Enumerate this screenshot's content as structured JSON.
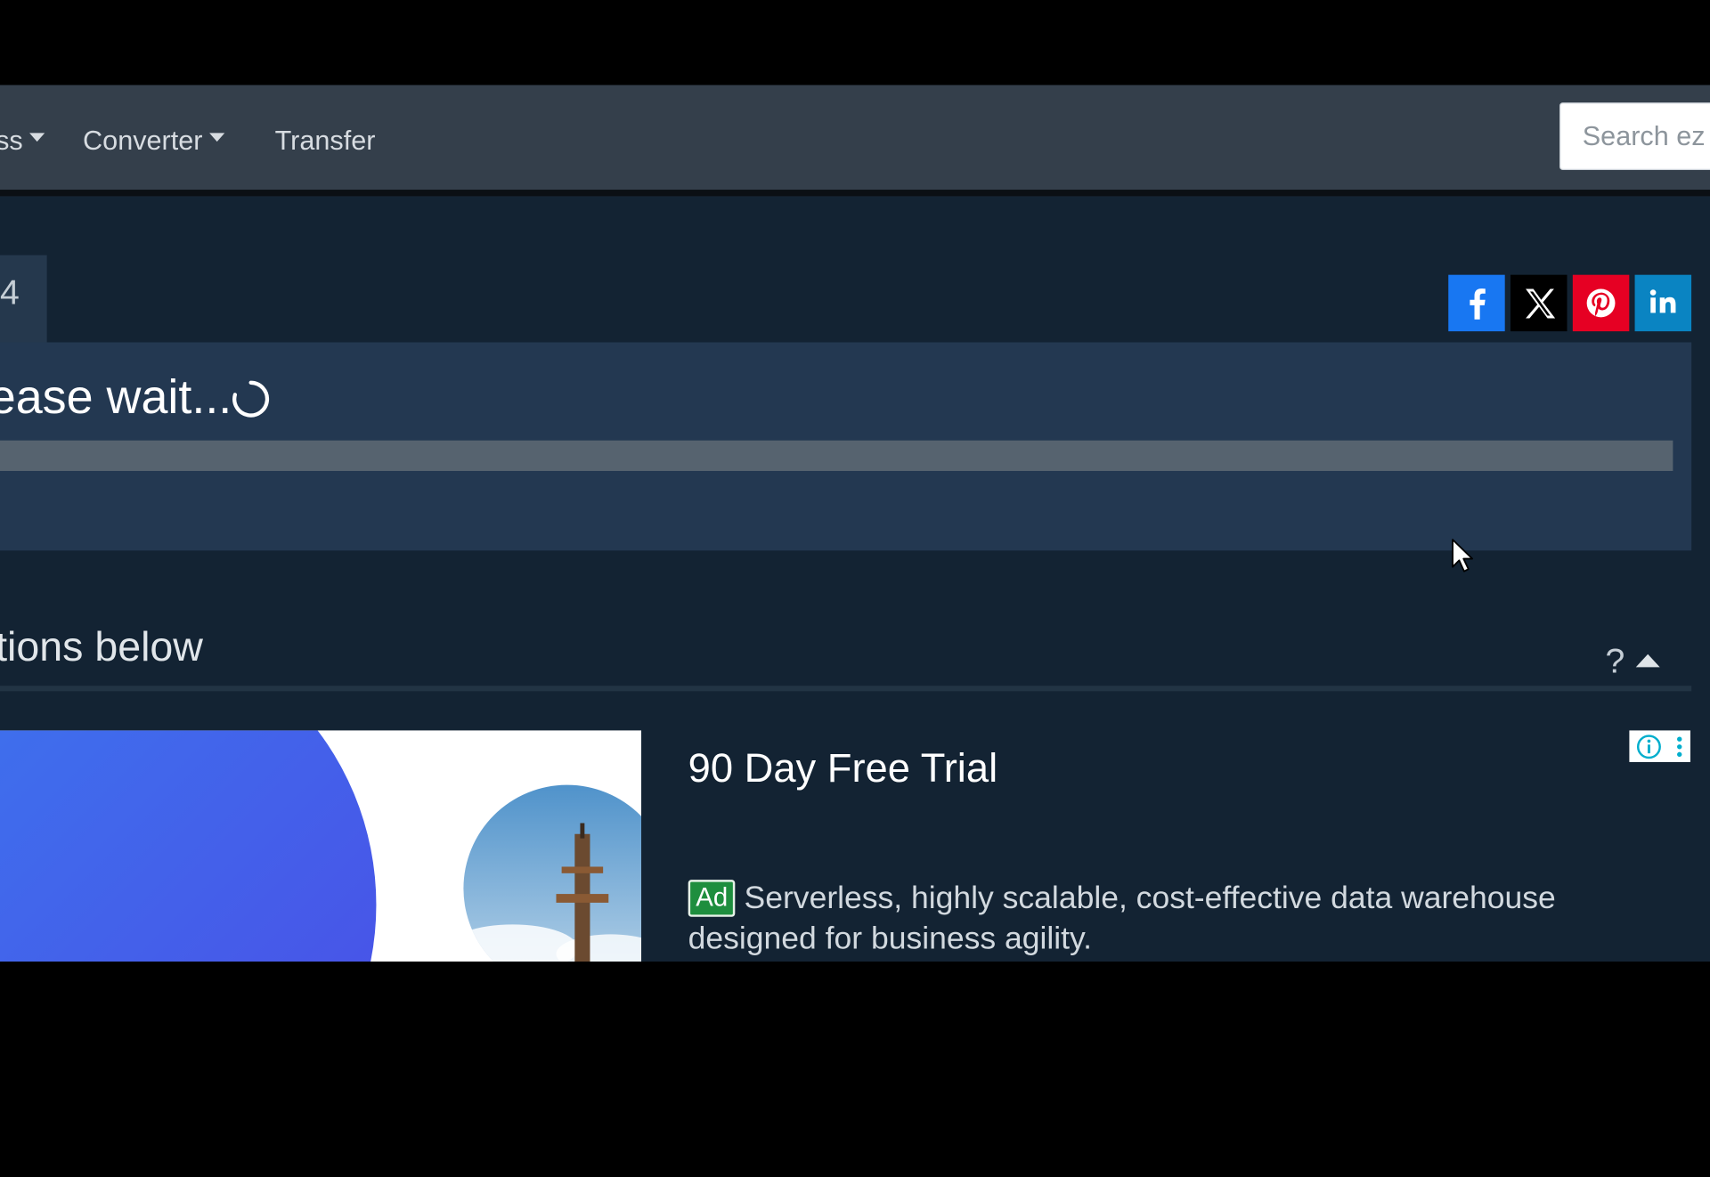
{
  "nav": {
    "items": [
      {
        "label": "ss",
        "has_caret": true
      },
      {
        "label": "Converter",
        "has_caret": true
      },
      {
        "label": "Transfer",
        "has_caret": false
      }
    ],
    "search_placeholder": "Search ez"
  },
  "tab_stub_text": "4",
  "share": {
    "buttons": [
      {
        "name": "facebook",
        "icon": "facebook-icon",
        "color": "#1877f2"
      },
      {
        "name": "x",
        "icon": "x-icon",
        "color": "#000000"
      },
      {
        "name": "pinterest",
        "icon": "pinterest-icon",
        "color": "#e60023"
      },
      {
        "name": "linkedin",
        "icon": "linkedin-icon",
        "color": "#0a84c2"
      }
    ]
  },
  "status": {
    "wait_text": "ease wait...",
    "progress_percent": 0
  },
  "options": {
    "heading": "tions below",
    "help_label": "?"
  },
  "ad": {
    "title": "90 Day Free Trial",
    "badge": "Ad",
    "description": "Serverless, highly scalable, cost-effective data warehouse designed for business agility."
  },
  "colors": {
    "background": "#132333",
    "navbar": "#343f4b",
    "panel": "#233851",
    "progress_track": "#56636f",
    "ad_badge": "#1e8e3e"
  }
}
